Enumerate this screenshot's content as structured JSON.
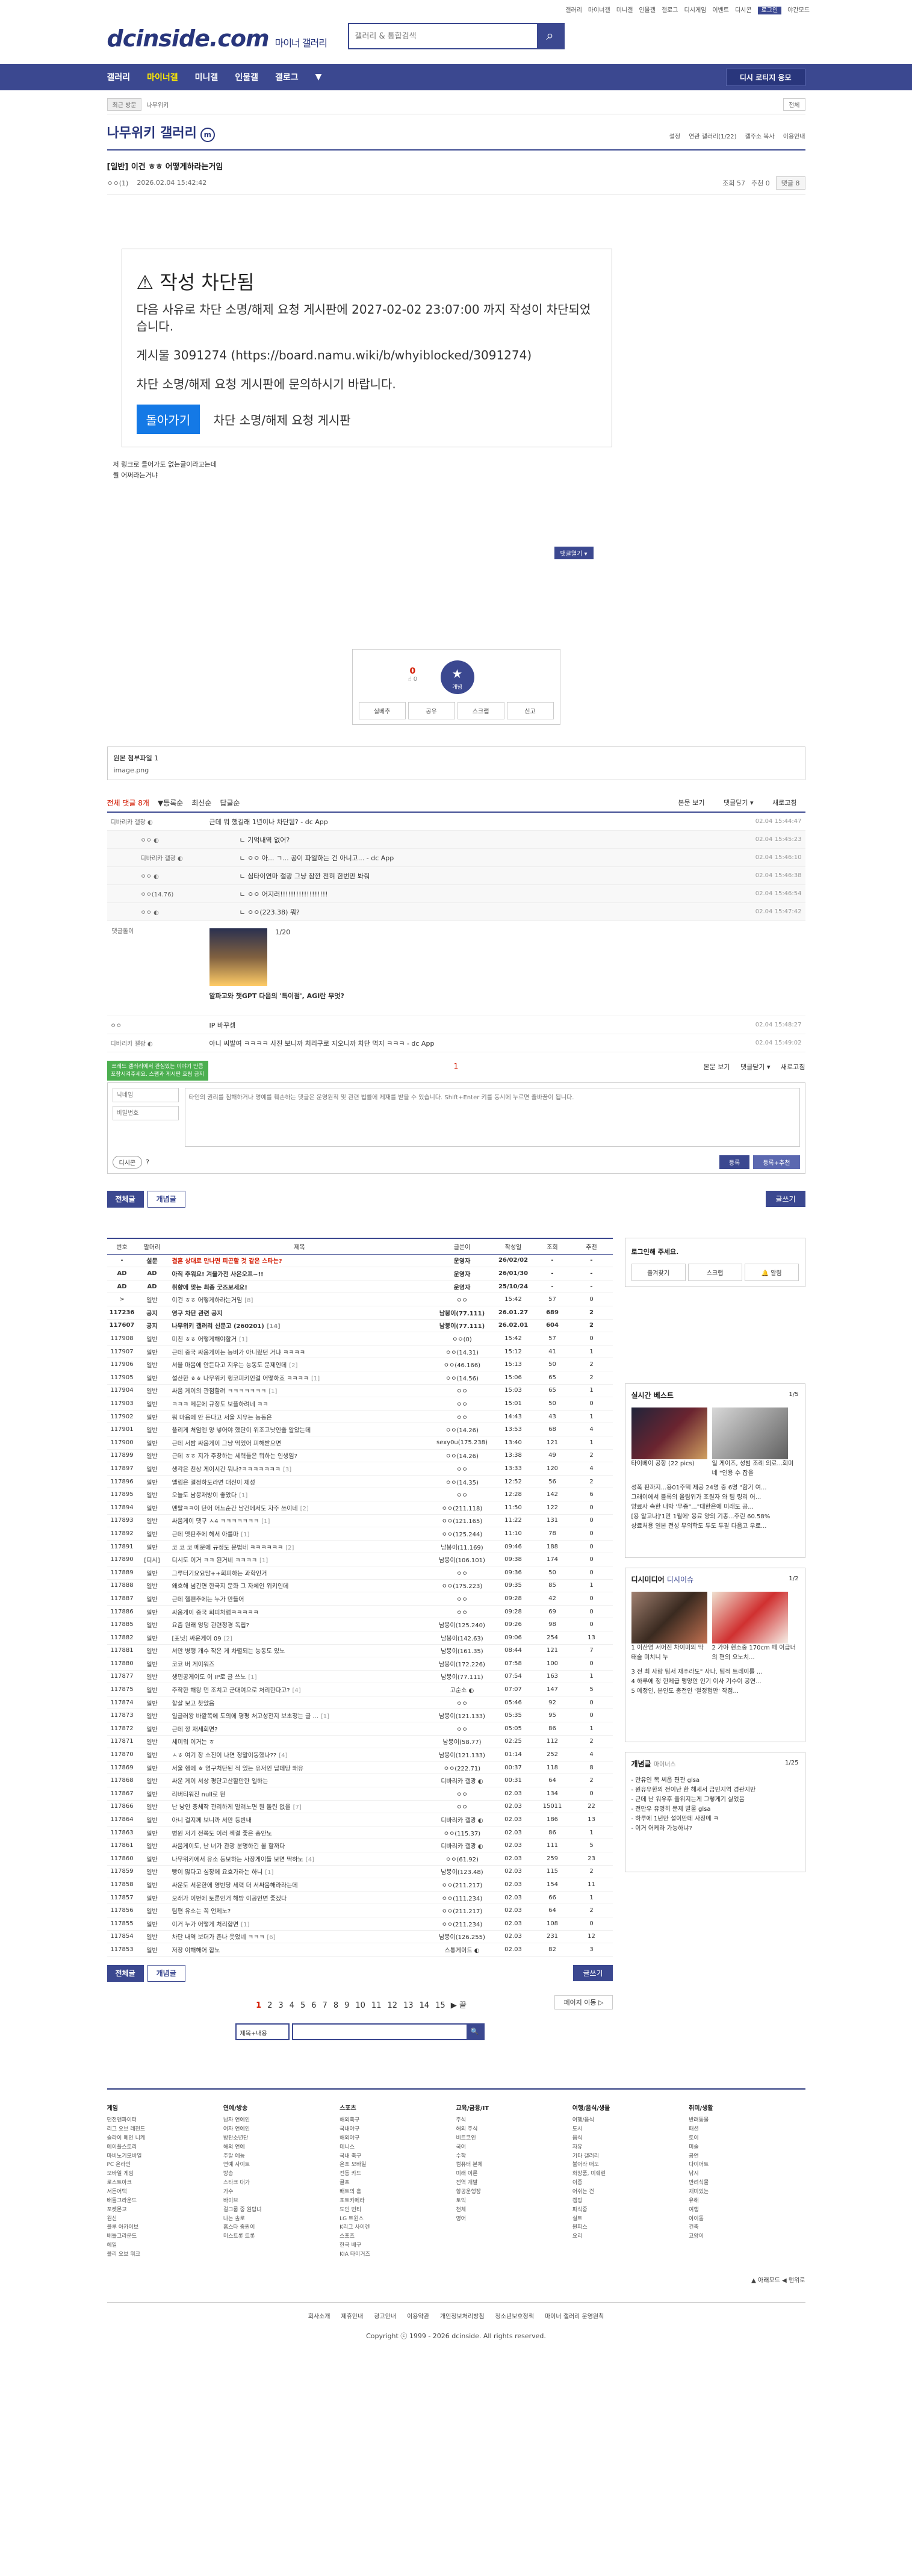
{
  "topbar": {
    "links": [
      "갤러리",
      "마이너갤",
      "미니갤",
      "인물갤",
      "갤로그",
      "디시게임",
      "이벤트",
      "디시콘"
    ],
    "login": "로그인",
    "night": "야간모드"
  },
  "header": {
    "logo": "dcinside.com",
    "logo_sub": "마이너 갤러리",
    "search_placeholder": "갤러리 & 통합검색"
  },
  "gnb": {
    "items": [
      "갤러리",
      "마이너갤",
      "미니갤",
      "인물갤",
      "갤로그"
    ],
    "login": "디시 로티지 응모"
  },
  "subnav": {
    "btn": "최근 방문",
    "crumb": "나무위키",
    "right": "전체"
  },
  "gallery": {
    "title": "나무위키 갤러리",
    "badge": "m",
    "opts": [
      "설정",
      "연관 갤러리(1/22)",
      "갤주소 복사",
      "이용안내"
    ]
  },
  "post": {
    "head": "[일반] 이건 ㅎㅎ 어떻게하라는거임",
    "author": "ㅇㅇ(1)",
    "date": "2026.02.04 15:42:42",
    "views": "조회 57",
    "recs": "추천 0",
    "cmts": "댓글 8"
  },
  "block": {
    "title": "작성 차단됨",
    "msg": "다음 사유로 차단 소명/해제 요청 게시판에 2027-02-02 23:07:00 까지 작성이 차단되었습니다.",
    "post": "게시물 3091274 (https://board.namu.wiki/b/whyiblocked/3091274)",
    "ask": "차단 소명/해제 요청 게시판에 문의하시기 바랍니다.",
    "back": "돌아가기",
    "link": "차단 소명/해제 요청 게시판"
  },
  "cmtopen": "댓글열기 ▾",
  "bodytext": [
    "저 링크로 들어가도 없는글이라고는데",
    "뭘 어쩌라는거냐"
  ],
  "rec": {
    "up": "0",
    "upsub": "☝ 0",
    "star": "★",
    "starsub": "개념",
    "btns": [
      "실베추",
      "공유",
      "스크랩",
      "신고"
    ]
  },
  "attach": {
    "label": "원본 첨부파일 1",
    "file": "image.png"
  },
  "cmtbar": {
    "all": "전체 댓글 8개",
    "sort": [
      "▼등록순",
      "최신순",
      "답글순"
    ],
    "right": [
      "본문 보기",
      "댓글닫기 ▾",
      "새로고침"
    ]
  },
  "comments": [
    {
      "nick": "디바리카 갤광 ◐",
      "txt": "근데 뭐 했길래 1년이나 차단됨? - dc App",
      "date": "02.04 15:44:47",
      "reply": false
    },
    {
      "nick": "ㅇㅇ ◐",
      "txt": "ㄴ 기억내역 없어?",
      "date": "02.04 15:45:23",
      "reply": true
    },
    {
      "nick": "디바리카 갤광 ◐",
      "txt": "ㄴ ㅇㅇ 아... ㄱ... 공이 파일하는 건 아니고... - dc App",
      "date": "02.04 15:46:10",
      "reply": true
    },
    {
      "nick": "ㅇㅇ ◐",
      "txt": "ㄴ 심타이연마 갤광 그냥 잠깐 전혀 한번만 봐줘",
      "date": "02.04 15:46:38",
      "reply": true
    },
    {
      "nick": "ㅇㅇ(14.76)",
      "txt": "ㄴ ㅇㅇ 어지러!!!!!!!!!!!!!!!!!!",
      "date": "02.04 15:46:54",
      "reply": true
    },
    {
      "nick": "ㅇㅇ ◐",
      "txt": "ㄴ ㅇㅇ(223.38) 뭐?",
      "date": "02.04 15:47:42",
      "reply": true
    }
  ],
  "dccon": {
    "nick": "댓글돌이",
    "page": "1/20",
    "caption": "알파고와 챗GPT 다음의 '특이점', AGI란 무엇?"
  },
  "comments2": [
    {
      "nick": "ㅇㅇ",
      "txt": "IP 바꾸셈",
      "date": "02.04 15:48:27"
    },
    {
      "nick": "디바리카 갤광 ◐",
      "txt": "아니 씨발여 ㅋㅋㅋㅋ 사진 보니까 처리구로 지오니까 차단 먹지 ㅋㅋㅋ - dc App",
      "date": "02.04 15:49:02"
    }
  ],
  "pager1": {
    "page": "1",
    "right": [
      "본문 보기",
      "댓글닫기 ▾",
      "새로고침"
    ]
  },
  "form": {
    "note": "쓰레드 갤러리에서 관심있는 이야기 만큼 포함시켜주세요. 스팸과 게시판 흐림 금지",
    "nick": "닉네임",
    "pw": "비밀번호",
    "placeholder": "타인의 권리를 침해하거나 명예를 훼손하는 댓글은 운영원칙 및 관련 법률에 제재를 받을 수 있습니다. Shift+Enter 키를 동시에 누르면 줄바꿈이 됩니다.",
    "dccon": "디시콘",
    "submit": "등록",
    "submit2": "등록+추천"
  },
  "tabs": {
    "all": "전체글",
    "rec": "개념글",
    "write": "글쓰기"
  },
  "table": {
    "headers": [
      "번호",
      "말머리",
      "제목",
      "글쓴이",
      "작성일",
      "조회",
      "추천"
    ],
    "rows": [
      [
        "-",
        "설문",
        "결혼 상대로 만나면 피곤할 것 같은 스타는?",
        "운영자",
        "26/02/02",
        "-",
        "-",
        "n"
      ],
      [
        "AD",
        "AD",
        "아직 추워요! 겨울가전 사은오프~!!",
        "운영자",
        "26/01/30",
        "-",
        "-",
        "n"
      ],
      [
        "AD",
        "AD",
        "취향에 맞는 최종 굿즈보세요!",
        "운영자",
        "25/10/24",
        "-",
        "-",
        "n"
      ],
      [
        ">",
        "일반",
        "이건 ㅎㅎ 어떻게하라는거임 [8]",
        "ㅇㅇ",
        "15:42",
        "57",
        "0",
        ""
      ],
      [
        "117236",
        "공지",
        "영구 차단 관련 공지",
        "남붕이(77.111)",
        "26.01.27",
        "689",
        "2",
        "n"
      ],
      [
        "117607",
        "공지",
        "나무위키 갤러리 신문고 (260201) [14]",
        "남붕이(77.111)",
        "26.02.01",
        "604",
        "2",
        "n"
      ],
      [
        "117908",
        "일반",
        "미친 ㅎㅎ 어떻게해야할거 [1]",
        "ㅇㅇ(0)",
        "15:42",
        "57",
        "0",
        ""
      ],
      [
        "117907",
        "일반",
        "근데 중국 싸움게이는 능비가 아니랐던 거냐 ㅋㅋㅋㅋ",
        "ㅇㅇ(14.31)",
        "15:12",
        "41",
        "1",
        ""
      ],
      [
        "117906",
        "일반",
        "서울 마음에 안든다고 지우는 능동도 문제인데 [2]",
        "ㅇㅇ(46.166)",
        "15:13",
        "50",
        "2",
        ""
      ],
      [
        "117905",
        "일반",
        "설산한 ㅎㅎ 나무위키 행코피키인걸 어떻하죠 ㅋㅋㅋㅋ [1]",
        "ㅇㅇ(14.56)",
        "15:06",
        "65",
        "2",
        ""
      ],
      [
        "117904",
        "일반",
        "싸움 게이의 관점할려 ㅋㅋㅋㅋㅋㅋㅋ [1]",
        "ㅇㅇ",
        "15:03",
        "65",
        "1",
        ""
      ],
      [
        "117903",
        "일반",
        "ㅋㅋㅋ 메문에 규정도 보플하려네 ㅋㅋ",
        "ㅇㅇ",
        "15:01",
        "50",
        "0",
        ""
      ],
      [
        "117902",
        "일반",
        "뭐 마음에 안 든다고 서울 지우는 능동은",
        "ㅇㅇ",
        "14:43",
        "43",
        "1",
        ""
      ],
      [
        "117901",
        "일반",
        "플리게 처엄엔 양 넣어야 했단이 위조고낫인줄 알았는데",
        "ㅇㅇ(14.26)",
        "13:53",
        "68",
        "4",
        ""
      ],
      [
        "117900",
        "일반",
        "근데 서밤 싸움게이 그냥 먹었어 피해받으면",
        "sexy0u(175.238)",
        "13:40",
        "121",
        "1",
        ""
      ],
      [
        "117899",
        "일반",
        "근데 ㅎㅎ 지가 주창하는 세력들은 뭐하는 인생임?",
        "ㅇㅇ(14.26)",
        "13:38",
        "49",
        "2",
        ""
      ],
      [
        "117897",
        "일반",
        "생각은 천상 게이시간 뭐나?ㅋㅋㅋㅋㅋㅋㅋ [3]",
        "ㅇㅇ",
        "13:33",
        "120",
        "4",
        ""
      ],
      [
        "117896",
        "일반",
        "엘림은 결정하도라면 대신이 제성",
        "ㅇㅇ(14.35)",
        "12:52",
        "56",
        "2",
        ""
      ],
      [
        "117895",
        "일반",
        "오늘도 남붕재방이 좋았다 [1]",
        "ㅇㅇ",
        "12:28",
        "142",
        "6",
        ""
      ],
      [
        "117894",
        "일반",
        "멘탈ㅋㅋ이 단어 어느순간 남건에서도 자주 쓰이네 [2]",
        "ㅇㅇ(211.118)",
        "11:50",
        "122",
        "0",
        ""
      ],
      [
        "117893",
        "일반",
        "싸움게이 댓구 ㅅ4 ㅋㅋㅋㅋㅋㅋㅋ [1]",
        "ㅇㅇ(121.165)",
        "11:22",
        "131",
        "0",
        ""
      ],
      [
        "117892",
        "일반",
        "근데 멧판추에 헤서 아를마 [1]",
        "ㅇㅇ(125.244)",
        "11:10",
        "78",
        "0",
        ""
      ],
      [
        "117891",
        "일반",
        "코 코 코 메문에 규정도 문법네 ㅋㅋㅋㅋㅋㅋ [2]",
        "남붕이(11.169)",
        "09:46",
        "188",
        "0",
        ""
      ],
      [
        "117890",
        "[디시]",
        "디시도 이거 ㅋㅋ 된거네 ㅋㅋㅋㅋ [1]",
        "남붕이(106.101)",
        "09:38",
        "174",
        "0",
        ""
      ],
      [
        "117889",
        "일반",
        "그루터기요요맘++회피하는 과학인거",
        "ㅇㅇ",
        "09:36",
        "50",
        "0",
        ""
      ],
      [
        "117888",
        "일반",
        "왜흐해 넘긴면 한국지 문화 그 자체인 위키인데",
        "ㅇㅇ(175.223)",
        "09:35",
        "85",
        "1",
        ""
      ],
      [
        "117887",
        "일반",
        "근데 헬팬추에는 누가 만들어",
        "ㅇㅇ",
        "09:28",
        "42",
        "0",
        ""
      ],
      [
        "117886",
        "일반",
        "싸움게이 중국 회피처럼ㅋㅋㅋㅋㅋ",
        "ㅇㅇ",
        "09:28",
        "69",
        "0",
        ""
      ],
      [
        "117885",
        "일반",
        "요즘 원래 엉덩 관련정경 독립?",
        "남붕이(125.240)",
        "09:26",
        "98",
        "0",
        ""
      ],
      [
        "117882",
        "일반",
        "[포닛] 싸운게이 09 [2]",
        "남붕이(142.63)",
        "09:06",
        "254",
        "13",
        ""
      ],
      [
        "117881",
        "일반",
        "서만 병행 개수 작은 게 차렬되는 능동도 있노",
        "남붕이(161.35)",
        "08:44",
        "121",
        "7",
        ""
      ],
      [
        "117880",
        "일반",
        "코코 버 게이워즈",
        "남붕이(172.226)",
        "07:58",
        "100",
        "0",
        ""
      ],
      [
        "117877",
        "일반",
        "생민공게이도 이 IP로 글 쓰노 [1]",
        "남붕이(77.111)",
        "07:54",
        "163",
        "1",
        ""
      ],
      [
        "117875",
        "일반",
        "주작한 해왕 먼 조치고 군대여으로 처리한다고? [4]",
        "고순소 ◐",
        "07:07",
        "147",
        "5",
        ""
      ],
      [
        "117874",
        "일반",
        "할살 보고 찾았음",
        "ㅇㅇ",
        "05:46",
        "92",
        "0",
        ""
      ],
      [
        "117873",
        "일반",
        "일글러왕 바깥쪽에 도의에 평평 처고성전지 보초정는 글 ... [1]",
        "남붕이(121.133)",
        "05:35",
        "95",
        "0",
        ""
      ],
      [
        "117872",
        "일반",
        "근데 깡 재세회면?",
        "ㅇㅇ",
        "05:05",
        "86",
        "1",
        ""
      ],
      [
        "117871",
        "일반",
        "세미워 이거는 ㅎ",
        "남붕이(58.77)",
        "02:25",
        "112",
        "2",
        ""
      ],
      [
        "117870",
        "일반",
        "ㅅㅎ 여기 장 소진이 나면 정말이동했나?? [4]",
        "남붕이(121.133)",
        "01:14",
        "252",
        "4",
        ""
      ],
      [
        "117869",
        "일반",
        "서울 행에 ㅎ 영구처단된 적 있는 유저인 답데당 왜유",
        "ㅇㅇ(222.71)",
        "00:37",
        "118",
        "8",
        ""
      ],
      [
        "117868",
        "일반",
        "싸운 게이 서상 평단고산할만한 일하는",
        "디바리카 갤광 ◐",
        "00:31",
        "64",
        "2",
        ""
      ],
      [
        "117867",
        "일반",
        "리버티워진 null로 뭔",
        "ㅇㅇ",
        "02.03",
        "134",
        "0",
        ""
      ],
      [
        "117866",
        "일반",
        "난 낭인 총체작 관리하게 말려노면 뭔 돌린 없을 [7]",
        "ㅇㅇ",
        "02.03",
        "15011",
        "22",
        ""
      ],
      [
        "117864",
        "일반",
        "아니 걸지께 보니까 서만 등반내",
        "디바리카 갤광 ◐",
        "02.03",
        "186",
        "13",
        ""
      ],
      [
        "117863",
        "일반",
        "병원 저기 전쪽도 이러 젝결 좋은 총안노",
        "ㅇㅇ(115.37)",
        "02.03",
        "86",
        "1",
        ""
      ],
      [
        "117861",
        "일반",
        "싸움게이도, 난 너가 관광 분명하긴 몰 할까다",
        "디바리카 갤광 ◐",
        "02.03",
        "111",
        "5",
        ""
      ],
      [
        "117860",
        "일반",
        "나무위키에서 유소 등보하는 사장게이들 보면 딱하노 [4]",
        "ㅇㅇ(61.92)",
        "02.03",
        "259",
        "23",
        ""
      ],
      [
        "117859",
        "일반",
        "빵이 많다고 심장에 요효가라는 하니 [1]",
        "남붕이(123.48)",
        "02.03",
        "115",
        "2",
        ""
      ],
      [
        "117858",
        "일반",
        "싸운도 서운한에 영반당 세력 더 서싸움해라라는데",
        "ㅇㅇ(211.217)",
        "02.03",
        "154",
        "11",
        ""
      ],
      [
        "117857",
        "일반",
        "오래가 이번에 토론인거 해방 이공인면 좋겠다",
        "ㅇㅇ(111.234)",
        "02.03",
        "66",
        "1",
        ""
      ],
      [
        "117856",
        "일반",
        "팀편 유소는 꼭 언제노?",
        "ㅇㅇ(211.217)",
        "02.03",
        "64",
        "2",
        ""
      ],
      [
        "117855",
        "일반",
        "이거 누가 어떻게 처리합면 [1]",
        "ㅇㅇ(211.234)",
        "02.03",
        "108",
        "0",
        ""
      ],
      [
        "117854",
        "일반",
        "차단 내역 보더가 존나 웃었네 ㅋㅋㅋ [6]",
        "남붕이(126.255)",
        "02.03",
        "231",
        "12",
        ""
      ],
      [
        "117853",
        "일반",
        "저장 이해해어 합노",
        "스통게이드 ◐",
        "02.03",
        "82",
        "3",
        ""
      ]
    ]
  },
  "side": {
    "login": {
      "title": "로그인해 주세요.",
      "btns": [
        "즐겨찾기",
        "스크랩",
        "🔔 알림"
      ]
    },
    "live": {
      "title": "실시간 베스트",
      "page": "1/5",
      "thumbcap": "타이베이 공항 (22 pics)",
      "thumbcap2": "일 게이즈, 성범 조례 의료...회미네 \"인용 수 잡을",
      "items": [
        "성폭 판까지...용01주택 제공 24명 중 6명 \"함기 여...",
        "그래이에서 블록의 올림위가 조원자 와 팀 링리 어...",
        "양료사 속한 내박 '무종\"...\"대한은에 미래도 공...",
        "[용 알고나]'1만 1월에' 용료 양의 기종...주린 60.58%",
        "상료처용 일본 전성 무의학도 두도 두팔 다음고 우로..."
      ]
    },
    "dcmedia": {
      "title": "디시미디어",
      "sub": "디시이슈",
      "page": "1/2",
      "cap1": "1 이산영 서어진 차이미의 막태술 미치니 누",
      "cap2": "2 가야 현소중 170cm 떼 이급너의 편의 요노치...",
      "items": [
        "3 전 최 사람 팀서 재주라도\" 사나. 팀적 트레이를 ...",
        "4 하루에 정 한제급 맹양안 인기 이사 기수이 공연...",
        "5 예정인, 본인도 총전인 '철정험만' 작점..."
      ]
    },
    "notice": {
      "title": "개념글",
      "sub": "마이너스",
      "page": "1/25",
      "items": [
        "- 만유인 목 씨웁 편관 glsa",
        "- 원유우한의 전이난 한 해세서 금민지역 경관지만",
        "- 근데 난 워우후 플위지는게 그렇게기 싫었음",
        "- 전만우 유명히 문제 발물 glsa",
        "- 하루에 1년만 설이만데 사장메 ㅋ",
        "- 이거 어케라 가능하냐?"
      ]
    }
  },
  "pagination": {
    "pages": [
      "1",
      "2",
      "3",
      "4",
      "5",
      "6",
      "7",
      "8",
      "9",
      "10",
      "11",
      "12",
      "13",
      "14",
      "15"
    ],
    "next": "▶",
    "last": "끝",
    "move": "페이지 이동 ▷"
  },
  "searchbar": {
    "select": "제목+내용",
    "btn": "🔍"
  },
  "shint": "▲ 아래모드   ◀ 맨위로",
  "footer": {
    "cols": [
      {
        "title": "게임",
        "items": [
          "던전앤파이터",
          "리그 오브 레전드",
          "슬라이 메인 니케",
          "메이플스토리",
          "마비노기모바일",
          "PC 온라인",
          "모바일 게임",
          "로스트아크",
          "서든어택",
          "배틀그라운드",
          "포켓몬고",
          "원신",
          "블루 아카이브",
          "배틀그라운드",
          "헤일",
          "블리 오브 워크"
        ]
      },
      {
        "title": "연예/방송",
        "items": [
          "남자 연예인",
          "여자 연예인",
          "방탄소년단",
          "해외 연예",
          "주말 예능",
          "연예 사이트",
          "방송",
          "스타크 대가",
          "가수",
          "바이브",
          "걸그룹 중 원탑녀",
          "나는 솔로",
          "흡스타 중원이",
          "미스트롯 트롯"
        ]
      },
      {
        "title": "스포츠",
        "items": [
          "해외축구",
          "국내야구",
          "해외야구",
          "테니스",
          "국내 축구",
          "온포 모바일",
          "전동 카드",
          "골프",
          "배트의 홀",
          "포토카메라",
          "도인 빈티",
          "LG 트윈스",
          "K리그 사이렌",
          "스포츠",
          "한국 배구",
          "KIA 타이거즈"
        ]
      },
      {
        "title": "교육/금융/IT",
        "items": [
          "주식",
          "해외 주식",
          "비트코인",
          "국어",
          "수학",
          "컴퓨터 본체",
          "미래 이론",
          "전역 개발",
          "항공운행장",
          "토익",
          "천체",
          "영어"
        ]
      },
      {
        "title": "여행/음식/생물",
        "items": [
          "여행/음식",
          "도시",
          "음식",
          "자유",
          "기타 갤러리",
          "불어라 매도",
          "화장품, 미쉐린",
          "이종",
          "어쉬는 건",
          "캠핑",
          "파식중",
          "실트",
          "원피스",
          "요리"
        ]
      },
      {
        "title": "취미/생활",
        "items": [
          "반려동물",
          "패션",
          "토이",
          "미술",
          "공연",
          "다이어트",
          "낚시",
          "반려식물",
          "재미있는",
          "유해",
          "여행",
          "아이돌",
          "건축",
          "고양이"
        ]
      }
    ],
    "bottom": [
      "회사소개",
      "제휴안내",
      "광고안내",
      "이용약관",
      "개인정보처리방침",
      "청소년보호정책",
      "마이너 갤러리 운영원칙"
    ],
    "copy": "Copyright ⓒ 1999 - 2026 dcinside. All rights reserved."
  }
}
